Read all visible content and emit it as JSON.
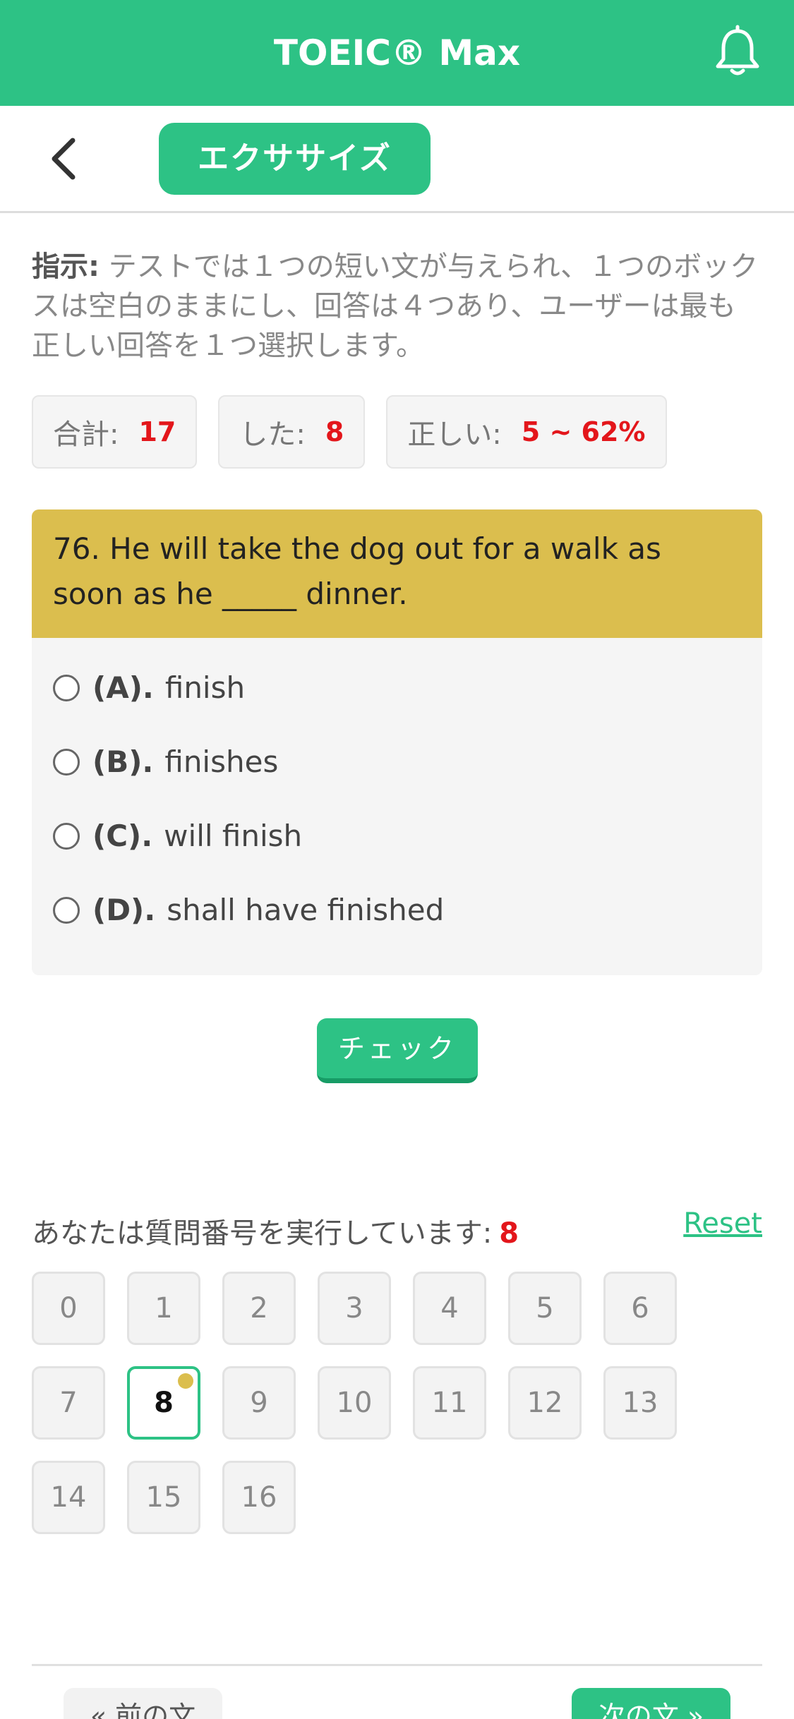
{
  "header": {
    "title": "TOEIC® Max",
    "icon": "bell-icon"
  },
  "subnav": {
    "tab_label": "エクササイズ",
    "back_icon": "chevron-left-icon"
  },
  "instruction": {
    "label": "指示:",
    "text": " テストでは１つの短い文が与えられ、１つのボックスは空白のままにし、回答は４つあり、ユーザーは最も正しい回答を１つ選択します。"
  },
  "stats": {
    "total_label": "合計:",
    "total_value": "17",
    "done_label": "した:",
    "done_value": "8",
    "correct_label": "正しい:",
    "correct_value": "5 ~ 62%"
  },
  "question": {
    "text": "76. He will take the dog out for a walk as soon as he _____ dinner.",
    "options": [
      {
        "letter": "(A).",
        "text": "finish"
      },
      {
        "letter": "(B).",
        "text": "finishes"
      },
      {
        "letter": "(C).",
        "text": "will finish"
      },
      {
        "letter": "(D).",
        "text": "shall have finished"
      }
    ]
  },
  "check_label": "チェック",
  "progress": {
    "label": "あなたは質問番号を実行しています:",
    "current": "8",
    "reset_label": "Reset"
  },
  "numbers": [
    "0",
    "1",
    "2",
    "3",
    "4",
    "5",
    "6",
    "7",
    "8",
    "9",
    "10",
    "11",
    "12",
    "13",
    "14",
    "15",
    "16"
  ],
  "nav": {
    "prev_label": "« 前の文",
    "next_label": "次の文 »"
  },
  "colors": {
    "brand": "#2dc285",
    "question_bg": "#dbbe4e",
    "accent_red": "#e3161b"
  }
}
